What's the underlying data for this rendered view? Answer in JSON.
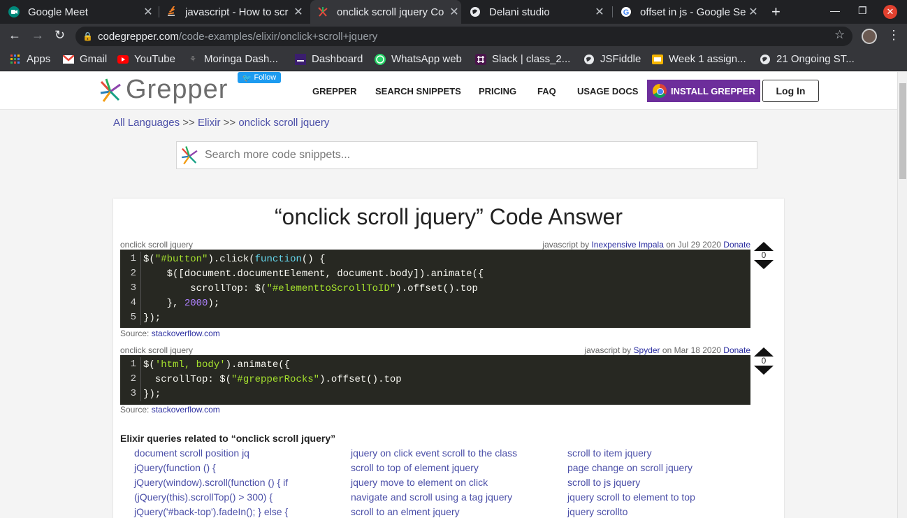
{
  "browser": {
    "tabs": [
      {
        "title": "Google Meet",
        "icon": "google-meet-icon"
      },
      {
        "title": "javascript - How to scr",
        "icon": "stackoverflow-icon"
      },
      {
        "title": "onclick scroll jquery Co",
        "icon": "grepper-icon",
        "active": true
      },
      {
        "title": "Delani studio",
        "icon": "globe-icon"
      },
      {
        "title": "offset in js - Google Se",
        "icon": "google-icon"
      }
    ],
    "url_domain": "codegrepper.com",
    "url_path": "/code-examples/elixir/onclick+scroll+jquery",
    "bookmarks": [
      {
        "label": "Apps",
        "icon": "apps-grid-icon",
        "color": "#4285f4"
      },
      {
        "label": "Gmail",
        "icon": "gmail-icon",
        "color": "#ea4335"
      },
      {
        "label": "YouTube",
        "icon": "youtube-icon",
        "color": "#ff0000"
      },
      {
        "label": "Moringa Dash...",
        "icon": "moringa-icon",
        "color": "#888888"
      },
      {
        "label": "Dashboard",
        "icon": "dashboard-icon",
        "color": "#3b1e6e"
      },
      {
        "label": "WhatsApp web",
        "icon": "whatsapp-icon",
        "color": "#25d366"
      },
      {
        "label": "Slack | class_2...",
        "icon": "slack-icon",
        "color": "#4a154b"
      },
      {
        "label": "JSFiddle",
        "icon": "globe-icon",
        "color": "#e8eaed"
      },
      {
        "label": "Week 1 assign...",
        "icon": "docs-icon",
        "color": "#f4b400"
      },
      {
        "label": "21 Ongoing ST...",
        "icon": "globe-icon",
        "color": "#e8eaed"
      }
    ]
  },
  "header": {
    "logo_text": "Grepper",
    "follow_label": "Follow",
    "nav": [
      "GREPPER",
      "SEARCH SNIPPETS",
      "PRICING",
      "FAQ",
      "USAGE DOCS"
    ],
    "install_label": "INSTALL GREPPER",
    "login_label": "Log In",
    "accent": "#6d2e9b"
  },
  "breadcrumb": {
    "all": "All Languages",
    "sep": ">>",
    "lang": "Elixir",
    "current": "onclick scroll jquery"
  },
  "search": {
    "placeholder": "Search more code snippets..."
  },
  "answer": {
    "title": "“onclick scroll jquery” Code Answer",
    "snippets": [
      {
        "label": "onclick scroll jquery",
        "lang_prefix": "javascript by",
        "author": "Inexpensive Impala",
        "date_text": "on Jul 29 2020",
        "donate": "Donate",
        "votes": "0",
        "source_label": "Source:",
        "source": "stackoverflow.com"
      },
      {
        "label": "onclick scroll jquery",
        "lang_prefix": "javascript by",
        "author": "Spyder",
        "date_text": "on Mar 18 2020",
        "donate": "Donate",
        "votes": "0",
        "source_label": "Source:",
        "source": "stackoverflow.com"
      }
    ]
  },
  "code1": [
    "$(\"#button\").click(function() {",
    "    $([document.documentElement, document.body]).animate({",
    "        scrollTop: $(\"#elementtoScrollToID\").offset().top",
    "    }, 2000);",
    "});"
  ],
  "code2": [
    "$('html, body').animate({",
    "  scrollTop: $(\"#grepperRocks\").offset().top",
    "});"
  ],
  "related": {
    "title": "Elixir queries related to “onclick scroll jquery”",
    "col1": [
      "document scroll position jq",
      "jQuery(function () {",
      "jQuery(window).scroll(function () { if",
      "(jQuery(this).scrollTop() > 300) {",
      "jQuery('#back-top').fadeIn(); } else {"
    ],
    "col2": [
      "jquery on click event scroll to the class",
      "scroll to top of element jquery",
      "jquery move to element on click",
      "navigate and scroll using a tag jquery",
      "scroll to an elment jquery"
    ],
    "col3": [
      "scroll to item jquery",
      "page change on scroll jquery",
      "scroll to js jquery",
      "jquery scroll to element to top",
      "jquery scrollto"
    ]
  }
}
